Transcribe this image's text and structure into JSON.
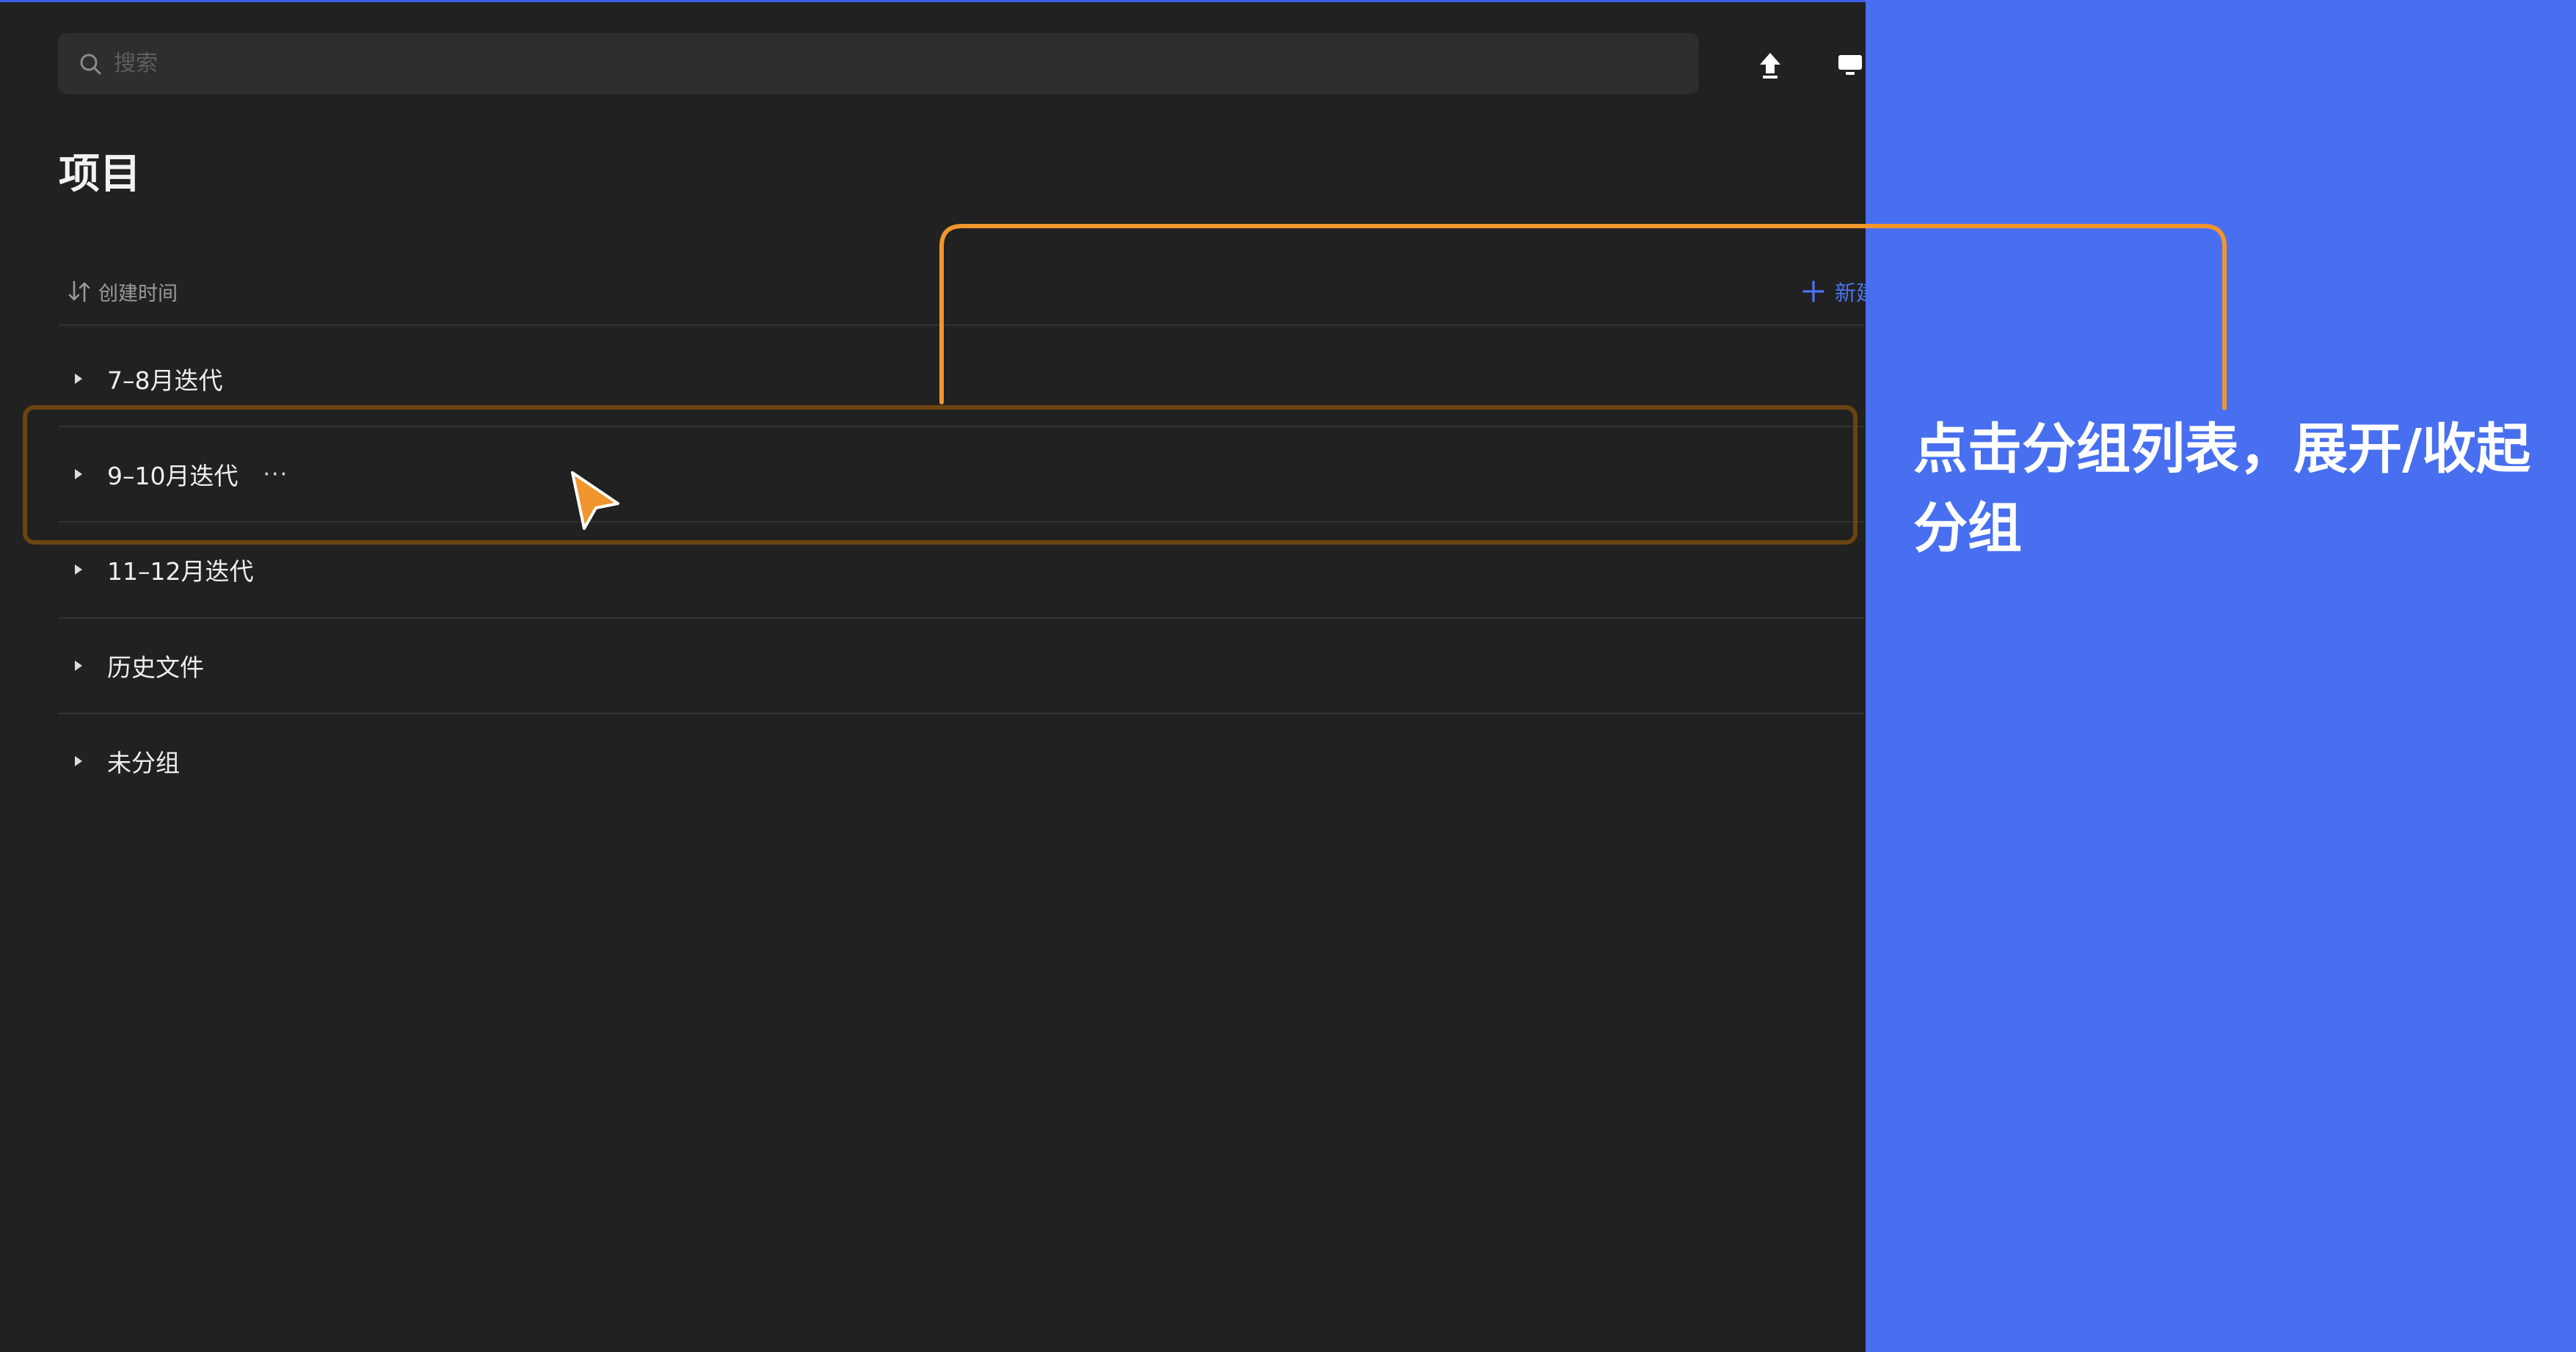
{
  "search": {
    "placeholder": "搜索"
  },
  "page": {
    "title": "项目"
  },
  "sort": {
    "label": "创建时间"
  },
  "new_group": {
    "label": "新建"
  },
  "groups": [
    {
      "label": "7–8月迭代"
    },
    {
      "label": "9–10月迭代",
      "more": "···"
    },
    {
      "label": "11–12月迭代"
    },
    {
      "label": "历史文件"
    },
    {
      "label": "未分组"
    }
  ],
  "callout": {
    "text": "点击分组列表，展开/收起分组"
  },
  "icons": {
    "search": "search-icon",
    "upload": "upload-icon",
    "monitor": "monitor-icon",
    "sort": "sort-icon",
    "plus": "plus-icon",
    "caret": "caret-right-icon",
    "cursor": "pointer-cursor-icon"
  },
  "colors": {
    "background": "#212121",
    "search_bg": "#2e2e2e",
    "accent_blue": "#4a74f0",
    "callout_panel": "#486ff0",
    "callout_line": "#f0962c",
    "highlight_border": "#6a4411"
  }
}
